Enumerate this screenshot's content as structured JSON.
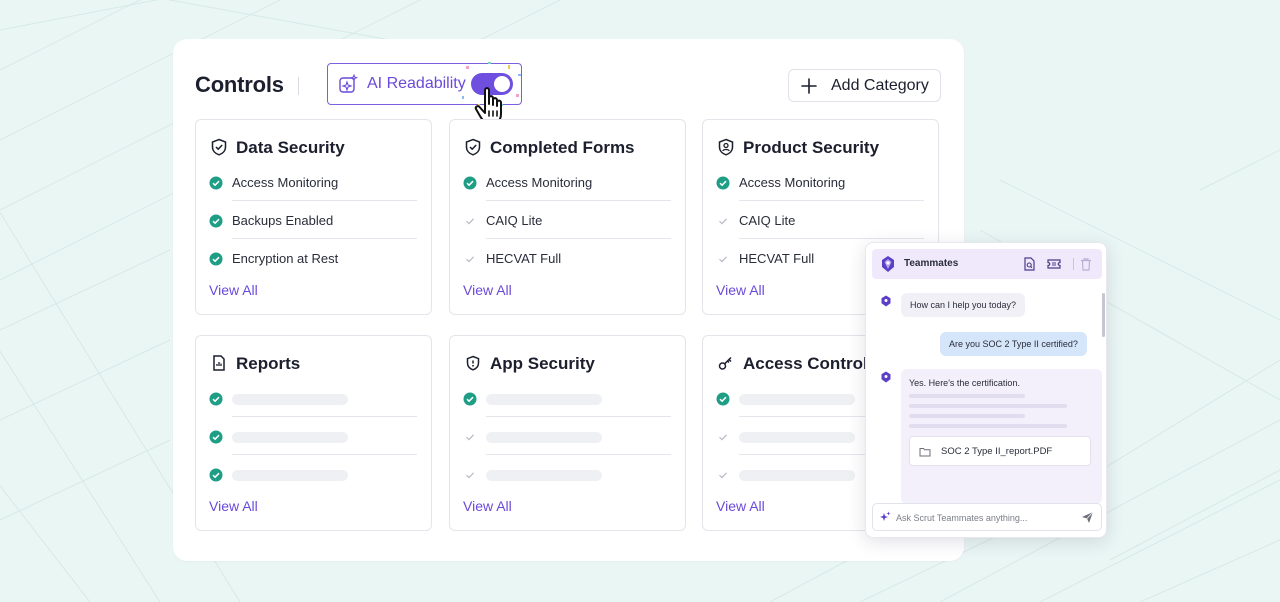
{
  "controls": {
    "title": "Controls",
    "ai_toggle_label": "AI Readability",
    "ai_toggle_on": true,
    "add_category_label": "Add Category",
    "view_all_label": "View All"
  },
  "cards": [
    {
      "title": "Data Security",
      "icon": "shield-check-icon",
      "items": [
        {
          "label": "Access Monitoring",
          "checked": true
        },
        {
          "label": "Backups Enabled",
          "checked": true
        },
        {
          "label": "Encryption at Rest",
          "checked": true
        }
      ]
    },
    {
      "title": "Completed Forms",
      "icon": "shield-check-icon",
      "items": [
        {
          "label": "Access Monitoring",
          "checked": true
        },
        {
          "label": "CAIQ Lite",
          "checked": false
        },
        {
          "label": "HECVAT Full",
          "checked": false
        }
      ]
    },
    {
      "title": "Product Security",
      "icon": "shield-user-icon",
      "items": [
        {
          "label": "Access Monitoring",
          "checked": true
        },
        {
          "label": "CAIQ Lite",
          "checked": false
        },
        {
          "label": "HECVAT Full",
          "checked": false
        }
      ]
    },
    {
      "title": "Reports",
      "icon": "report-file-icon",
      "items": [
        {
          "label": "",
          "checked": true
        },
        {
          "label": "",
          "checked": true
        },
        {
          "label": "",
          "checked": true
        }
      ]
    },
    {
      "title": "App Security",
      "icon": "shield-alert-icon",
      "items": [
        {
          "label": "",
          "checked": true
        },
        {
          "label": "",
          "checked": false
        },
        {
          "label": "",
          "checked": false
        }
      ]
    },
    {
      "title": "Access Controls",
      "icon": "key-icon",
      "items": [
        {
          "label": "",
          "checked": true
        },
        {
          "label": "",
          "checked": false
        },
        {
          "label": "",
          "checked": false
        }
      ]
    }
  ],
  "chat": {
    "title": "Teammates",
    "messages": {
      "bot_greeting": "How can I help you today?",
      "user_question": "Are you SOC 2 Type II certified?",
      "bot_answer": "Yes. Here's the certification."
    },
    "attachment_name": "SOC 2 Type II_report.PDF",
    "input_placeholder": "Ask Scrut Teammates anything..."
  },
  "colors": {
    "accent": "#6a4ad9",
    "check_green": "#1f9e86",
    "background": "#eaf6f4"
  }
}
